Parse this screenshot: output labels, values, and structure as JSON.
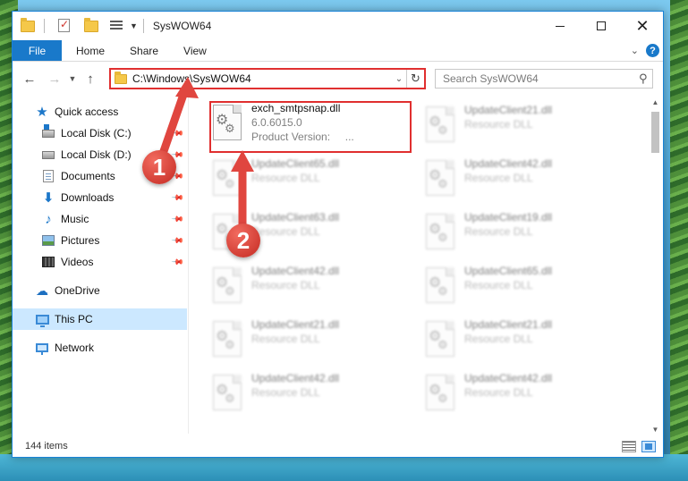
{
  "window": {
    "title": "SysWOW64"
  },
  "ribbon": {
    "tabs": [
      "File",
      "Home",
      "Share",
      "View"
    ]
  },
  "address": {
    "path": "C:\\Windows\\SysWOW64"
  },
  "search": {
    "placeholder": "Search SysWOW64"
  },
  "navpane": {
    "items": [
      {
        "label": "Quick access",
        "icon": "star-icon"
      },
      {
        "label": "Local Disk (C:)",
        "icon": "drive-icon"
      },
      {
        "label": "Local Disk (D:)",
        "icon": "drive-icon"
      },
      {
        "label": "Documents",
        "icon": "documents-icon"
      },
      {
        "label": "Downloads",
        "icon": "download-icon"
      },
      {
        "label": "Music",
        "icon": "music-icon"
      },
      {
        "label": "Pictures",
        "icon": "pictures-icon"
      },
      {
        "label": "Videos",
        "icon": "videos-icon"
      },
      {
        "label": "OneDrive",
        "icon": "cloud-icon"
      },
      {
        "label": "This PC",
        "icon": "computer-icon"
      },
      {
        "label": "Network",
        "icon": "network-icon"
      }
    ]
  },
  "files": {
    "highlighted": {
      "name": "exch_smtpsnap.dll",
      "version": "6.0.6015.0",
      "product_label": "Product Version:",
      "product_value": "..."
    },
    "col1": [
      {
        "name": "UpdateClient65.dll",
        "type": "Resource DLL"
      },
      {
        "name": "UpdateClient63.dll",
        "type": "Resource DLL"
      },
      {
        "name": "UpdateClient42.dll",
        "type": "Resource DLL"
      },
      {
        "name": "UpdateClient21.dll",
        "type": "Resource DLL"
      },
      {
        "name": "UpdateClient42.dll",
        "type": "Resource DLL"
      }
    ],
    "col2": [
      {
        "name": "UpdateClient21.dll",
        "type": "Resource DLL"
      },
      {
        "name": "UpdateClient42.dll",
        "type": "Resource DLL"
      },
      {
        "name": "UpdateClient19.dll",
        "type": "Resource DLL"
      },
      {
        "name": "UpdateClient65.dll",
        "type": "Resource DLL"
      },
      {
        "name": "UpdateClient21.dll",
        "type": "Resource DLL"
      },
      {
        "name": "UpdateClient42.dll",
        "type": "Resource DLL"
      }
    ]
  },
  "status": {
    "item_count": "144 items"
  },
  "annotations": {
    "badge1": "1",
    "badge2": "2",
    "color": "#e0463f"
  }
}
